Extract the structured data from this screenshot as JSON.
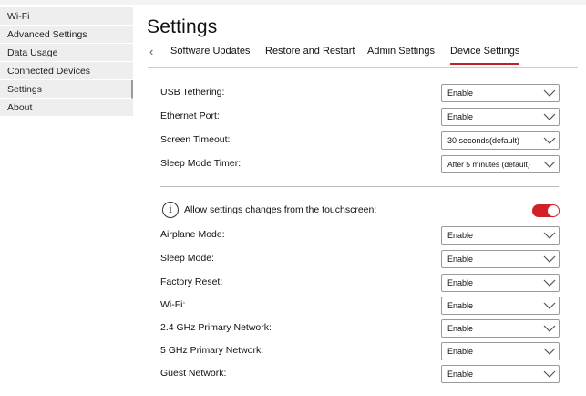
{
  "sidebar": {
    "items": [
      {
        "label": "Wi-Fi"
      },
      {
        "label": "Advanced Settings"
      },
      {
        "label": "Data Usage"
      },
      {
        "label": "Connected Devices"
      },
      {
        "label": "Settings"
      },
      {
        "label": "About"
      }
    ]
  },
  "page": {
    "title": "Settings"
  },
  "tabs": {
    "prev_icon": "chevron-left-icon",
    "items": [
      {
        "label": "Software Updates"
      },
      {
        "label": "Restore and Restart"
      },
      {
        "label": "Admin Settings"
      },
      {
        "label": "Device Settings",
        "active": true
      }
    ]
  },
  "device": {
    "rows": [
      {
        "label": "USB Tethering:",
        "value": "Enable"
      },
      {
        "label": "Ethernet Port:",
        "value": "Enable"
      },
      {
        "label": "Screen Timeout:",
        "value": "30 seconds(default)"
      },
      {
        "label": "Sleep Mode Timer:",
        "value": "After 5 minutes (default)"
      }
    ]
  },
  "touchscreen": {
    "icon": "info-icon",
    "info_glyph": "i",
    "label": "Allow settings changes from the touchscreen:",
    "toggle_on": true,
    "toggle_color": "#d21f26",
    "rows": [
      {
        "label": "Airplane Mode:",
        "value": "Enable"
      },
      {
        "label": "Sleep Mode:",
        "value": "Enable"
      },
      {
        "label": "Factory Reset:",
        "value": "Enable"
      },
      {
        "label": "Wi-Fi:",
        "value": "Enable"
      },
      {
        "label": "2.4 GHz Primary Network:",
        "value": "Enable"
      },
      {
        "label": "5 GHz Primary Network:",
        "value": "Enable"
      },
      {
        "label": "Guest Network:",
        "value": "Enable"
      }
    ]
  }
}
